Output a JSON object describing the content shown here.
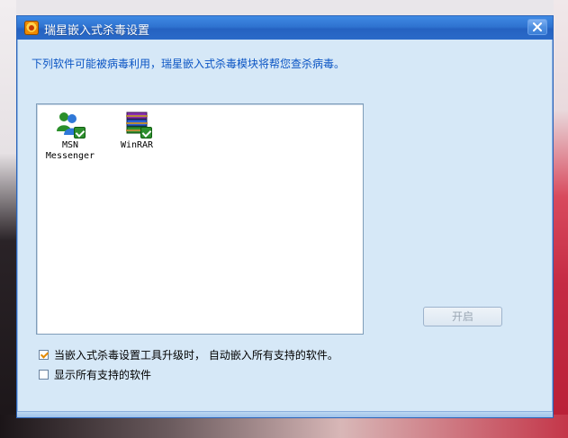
{
  "window": {
    "title": "瑞星嵌入式杀毒设置",
    "description": "下列软件可能被病毒利用，瑞星嵌入式杀毒模块将帮您查杀病毒。"
  },
  "software_list": {
    "items": [
      {
        "name": "MSN Messenger",
        "label_line1": "MSN",
        "label_line2": "Messenger",
        "icon": "msn-messenger-icon",
        "checked": true
      },
      {
        "name": "WinRAR",
        "label_line1": "WinRAR",
        "label_line2": "",
        "icon": "winrar-icon",
        "checked": true
      }
    ]
  },
  "buttons": {
    "start_label": "开启"
  },
  "options": {
    "auto_embed": {
      "label": "当嵌入式杀毒设置工具升级时， 自动嵌入所有支持的软件。",
      "checked": true
    },
    "show_all": {
      "label": "显示所有支持的软件",
      "checked": false
    }
  },
  "colors": {
    "titlebar": "#2f73d0",
    "accent_text": "#0b55c4",
    "panel_bg": "#d6e8f7"
  }
}
